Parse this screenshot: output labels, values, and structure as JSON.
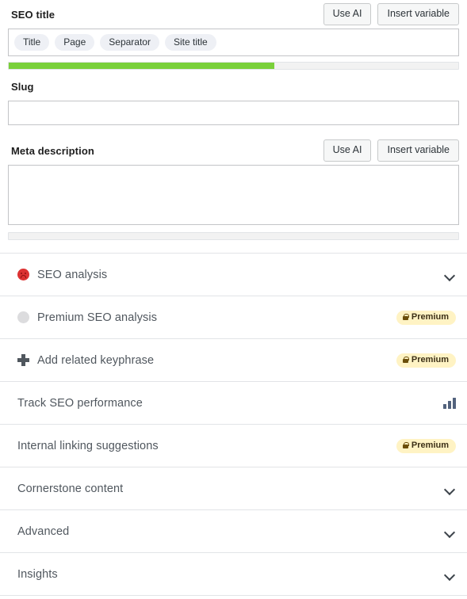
{
  "colors": {
    "progress_green": "#7ad03a",
    "bad_score_red": "#dc3232",
    "premium_badge_bg": "#fff3c4",
    "premium_badge_text": "#3c3017",
    "chart_icon": "#52627d",
    "border": "#c3c4c7"
  },
  "seo_title": {
    "label": "SEO title",
    "use_ai_label": "Use AI",
    "insert_variable_label": "Insert variable",
    "variables": [
      "Title",
      "Page",
      "Separator",
      "Site title"
    ],
    "progress_percent": 59
  },
  "slug": {
    "label": "Slug",
    "value": "",
    "placeholder": ""
  },
  "meta_description": {
    "label": "Meta description",
    "use_ai_label": "Use AI",
    "insert_variable_label": "Insert variable",
    "value": "",
    "placeholder": "",
    "progress_percent": 0
  },
  "panels": [
    {
      "title": "SEO analysis",
      "bullet": "bad-score-icon",
      "right": "chevron-down-icon",
      "badge": null
    },
    {
      "title": "Premium SEO analysis",
      "bullet": "gray-dot-icon",
      "right": "premium-badge",
      "badge": "Premium"
    },
    {
      "title": "Add related keyphrase",
      "bullet": "plus-icon",
      "right": "premium-badge",
      "badge": "Premium"
    },
    {
      "title": "Track SEO performance",
      "bullet": null,
      "right": "bar-chart-icon",
      "badge": null
    },
    {
      "title": "Internal linking suggestions",
      "bullet": null,
      "right": "premium-badge",
      "badge": "Premium"
    },
    {
      "title": "Cornerstone content",
      "bullet": null,
      "right": "chevron-down-icon",
      "badge": null
    },
    {
      "title": "Advanced",
      "bullet": null,
      "right": "chevron-down-icon",
      "badge": null
    },
    {
      "title": "Insights",
      "bullet": null,
      "right": "chevron-down-icon",
      "badge": null
    }
  ]
}
